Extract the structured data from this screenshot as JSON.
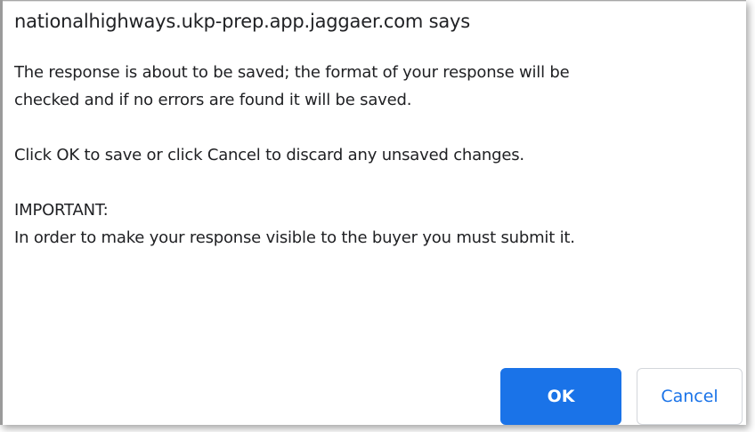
{
  "dialog": {
    "title": "nationalhighways.ukp-prep.app.jaggaer.com says",
    "message": {
      "line1": "The response is about to be saved; the format of your response will be",
      "line2": "checked and if no errors are found it will be saved.",
      "line3": "Click OK to save or click Cancel to discard any unsaved changes.",
      "line4": "IMPORTANT:",
      "line5": "In order to make your response visible to the buyer you must submit it."
    },
    "buttons": {
      "ok_label": "OK",
      "cancel_label": "Cancel"
    }
  },
  "colors": {
    "accent": "#1a73e8",
    "text": "#202124",
    "button_border": "#d3d6db"
  }
}
